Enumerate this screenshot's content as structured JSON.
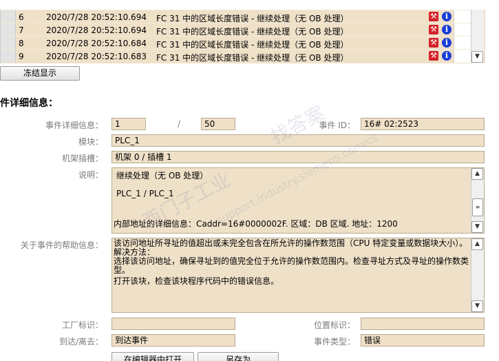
{
  "events": [
    {
      "num": "6",
      "time": "2020/7/28 20:52:10.694",
      "msg": "FC 31 中的区域长度错误 - 继续处理（无 OB 处理）"
    },
    {
      "num": "7",
      "time": "2020/7/28 20:52:10.694",
      "msg": "FC 31 中的区域长度错误 - 继续处理（无 OB 处理）"
    },
    {
      "num": "8",
      "time": "2020/7/28 20:52:10.684",
      "msg": "FC 31 中的区域长度错误 - 继续处理（无 OB 处理）"
    },
    {
      "num": "9",
      "time": "2020/7/28 20:52:10.683",
      "msg": "FC 31 中的区域长度错误 - 继续处理（无 OB 处理）"
    }
  ],
  "icons": {
    "wrench": "⚒",
    "info": "i"
  },
  "freeze_button": "冻结显示",
  "section_title": "件详细信息：",
  "details": {
    "event_detail_label": "事件详细信息：",
    "event_index": "1",
    "separator": "/",
    "event_total": "50",
    "event_id_label": "事件 ID：",
    "event_id": "16# 02:2523",
    "module_label": "模块：",
    "module": "PLC_1",
    "rack_label": "机架插槽：",
    "rack": "机架 0 / 插槽 1",
    "desc_label": "说明：",
    "desc_line1": "继续处理（无 OB 处理）",
    "desc_line2": "PLC_1 / PLC_1",
    "desc_line3": "内部地址的详细信息：Caddr=16#0000002F.  区域：DB 区域.  地址：1200",
    "help_label": "关于事件的帮助信息：",
    "help_line1": "该访问地址所寻址的值超出或未完全包含在所允许的操作数范围（CPU 特定变量或数据块大小）。",
    "help_line2": "解决方法：",
    "help_line3": "选择该访问地址，确保寻址到的值完全位于允许的操作数范围内。检查寻址方式及寻址的操作数类",
    "help_line4": "型。",
    "help_line5": "打开该块，检查该块程序代码中的错误信息。",
    "factory_label": "工厂标识：",
    "factory": "",
    "location_label": "位置标识：",
    "location": "",
    "arrive_label": "到达/离去：",
    "arrive": "到达事件",
    "type_label": "事件类型：",
    "type": "错误"
  },
  "buttons": {
    "open_editor": "在编辑器中打开",
    "save_as": "另存为"
  },
  "watermark": {
    "line1": "找答案",
    "line2": "support.industry.siemens.com/cs",
    "line3": "西门子工业"
  }
}
